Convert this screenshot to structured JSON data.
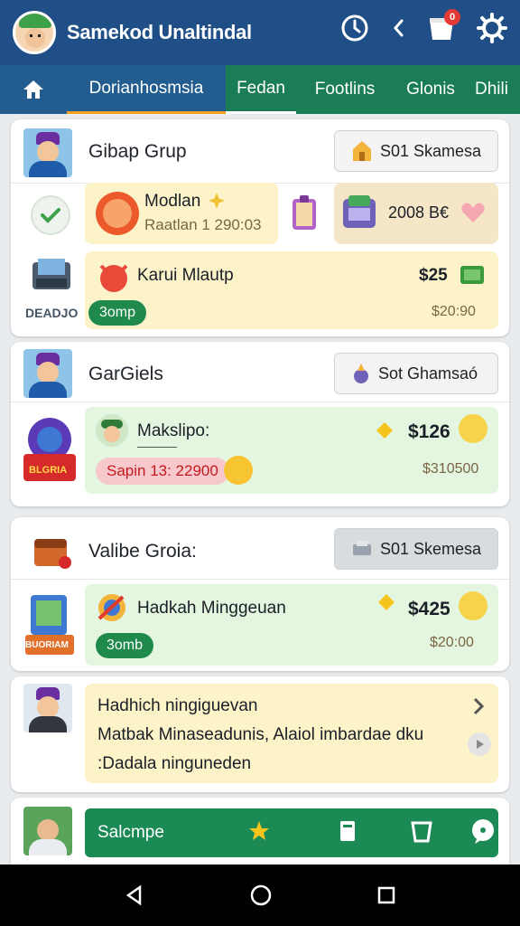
{
  "header": {
    "title": "Samekod Unaltindal",
    "notification_count": "0",
    "icons": [
      "history-icon",
      "back-icon",
      "cart-icon",
      "settings-icon"
    ]
  },
  "tabs": {
    "home_icon": "home-icon",
    "items": [
      "Dorianhosmsia",
      "Fedan",
      "Footlins",
      "Glonis",
      "Dhili"
    ]
  },
  "groups": [
    {
      "title": "Gibap Grup",
      "action_label": "S01 Skamesa",
      "label_small": "DEADJO",
      "row1": {
        "name": "Modlan",
        "sub": "Raatlan 1 290:03",
        "price": "2008 B€"
      },
      "row2": {
        "name": "Karui Mlautp",
        "price": "$25",
        "price_sub": "$20:90",
        "badge": "3omp"
      }
    },
    {
      "title": "GarGiels",
      "action_label": "Sot Ghamsaó",
      "label_small": "BLGRIA",
      "row1": {
        "name": "Makslipo:",
        "price": "$126",
        "price_sub": "$310500",
        "badge": "Sapin 13: 22900"
      }
    },
    {
      "title": "Valibe Groia:",
      "action_label": "S01 Skemesa",
      "label_small": "BUORIAM",
      "row1": {
        "name": "Hadkah Minggeuan",
        "price": "$425",
        "price_sub": "$20:00",
        "badge": "3omb"
      }
    }
  ],
  "message_card": {
    "line1": "Hadhich ningiguevan",
    "line2": "Matbak Minaseadunis, Alaiol imbardae dku",
    "line3": ":Dadala ninguneden"
  },
  "bottom_bar": {
    "label": "Salcmpe"
  },
  "colors": {
    "header": "#1f4f86",
    "tabs": "#1b7d55",
    "accent_green": "#1f8a4c",
    "accent_orange": "#f0a020"
  }
}
